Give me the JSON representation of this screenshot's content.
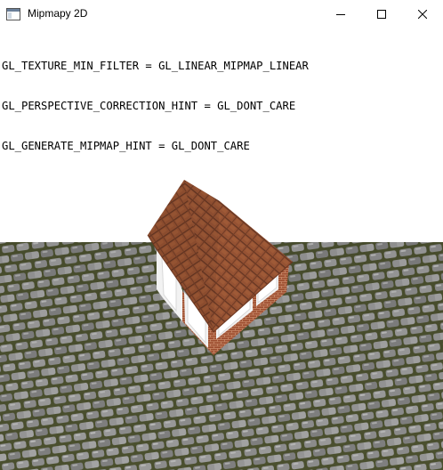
{
  "window": {
    "title": "Mipmapy 2D",
    "icon": "app-window-icon",
    "controls": {
      "minimize": "minimize-icon",
      "maximize": "maximize-icon",
      "close": "close-icon"
    }
  },
  "hud": {
    "lines": [
      "GL_TEXTURE_MIN_FILTER = GL_LINEAR_MIPMAP_LINEAR",
      "GL_PERSPECTIVE_CORRECTION_HINT = GL_DONT_CARE",
      "GL_GENERATE_MIPMAP_HINT = GL_DONT_CARE"
    ]
  },
  "colors": {
    "sky": "#ffffff",
    "text": "#000000",
    "cobblestone": "#8a8a8a",
    "cobblestone_grout": "#4d5230",
    "roof": "#8a4a2c",
    "brick_wall": "#9a4f30",
    "window_frame": "#f4f4f4"
  }
}
